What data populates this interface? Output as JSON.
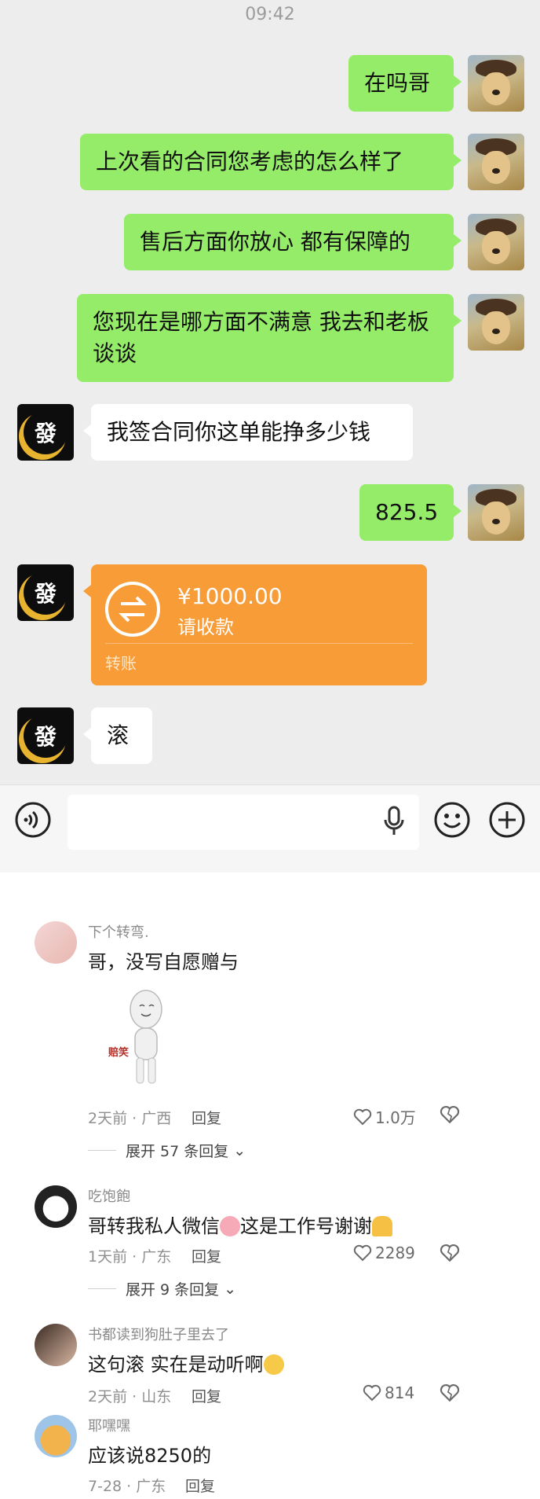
{
  "status_time": "09:42",
  "messages": [
    {
      "from": "me",
      "text": "在吗哥"
    },
    {
      "from": "me",
      "text": "上次看的合同您考虑的怎么样了"
    },
    {
      "from": "me",
      "text": "售后方面你放心 都有保障的"
    },
    {
      "from": "me",
      "text": "您现在是哪方面不满意 我去和老板谈谈"
    },
    {
      "from": "other",
      "text": "我签合同你这单能挣多少钱"
    },
    {
      "from": "me",
      "text": "825.5"
    },
    {
      "from": "other",
      "text": "滚"
    }
  ],
  "contact_avatar_glyph": "發",
  "transfer": {
    "amount": "¥1000.00",
    "note": "请收款",
    "label": "转账"
  },
  "comments": [
    {
      "name": "下个转弯.",
      "text": "哥，没写自愿赠与",
      "sticker_caption": "赔笑",
      "meta": "2天前 · 广西",
      "reply": "回复",
      "likes": "1.0万",
      "expand": "展开 57 条回复"
    },
    {
      "name": "吃饱飽",
      "text_before": "哥转我私人微信",
      "text_after": "这是工作号谢谢",
      "meta": "1天前 · 广东",
      "reply": "回复",
      "likes": "2289",
      "expand": "展开 9 条回复"
    },
    {
      "name": "书都读到狗肚子里去了",
      "text": "这句滚 实在是动听啊",
      "meta": "2天前 · 山东",
      "reply": "回复",
      "likes": "814"
    },
    {
      "name": "耶嘿嘿",
      "text": "应该说8250的",
      "meta": "7-28 · 广东",
      "reply": "回复"
    }
  ],
  "colors": {
    "my_bubble": "#95ec69",
    "transfer": "#f79c36",
    "chat_bg": "#ededed"
  }
}
